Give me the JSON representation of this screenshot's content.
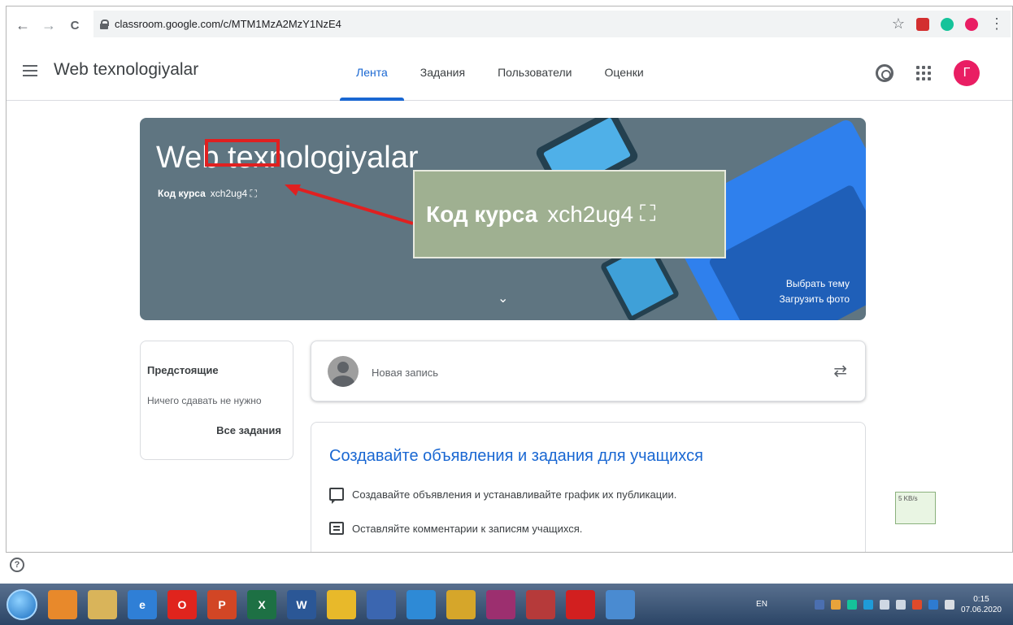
{
  "browser": {
    "url": "classroom.google.com/c/MTM1MzA2MzY1NzE4",
    "back_icon": "←",
    "forward_icon": "→",
    "reload_icon": "C"
  },
  "header": {
    "title": "Web texnologiyalar",
    "tabs": [
      {
        "label": "Лента",
        "active": true
      },
      {
        "label": "Задания"
      },
      {
        "label": "Пользователи"
      },
      {
        "label": "Оценки"
      }
    ],
    "avatar_letter": "Г"
  },
  "banner": {
    "title": "Web texnologiyalar",
    "code_label": "Код курса",
    "code_value": "xch2ug4",
    "select_theme": "Выбрать тему",
    "upload_photo": "Загрузить фото",
    "expand_icon": "⌄"
  },
  "callout": {
    "code_label": "Код курса",
    "code_value": "xch2ug4"
  },
  "upcoming": {
    "title": "Предстоящие",
    "subtitle": "Ничего сдавать не нужно",
    "link": "Все задания"
  },
  "new_post": {
    "placeholder": "Новая запись",
    "repost_icon": "⇄"
  },
  "info": {
    "title": "Создавайте объявления и задания для учащихся",
    "row1": "Создавайте объявления и устанавливайте график их публикации.",
    "row2": "Оставляйте комментарии к записям учащихся."
  },
  "net_widget": {
    "text": "5 KB/s"
  },
  "help_icon": "?",
  "taskbar": {
    "apps": [
      {
        "name": "media-player",
        "label": "",
        "color": "#e8892b"
      },
      {
        "name": "files",
        "label": "",
        "color": "#d9b45a"
      },
      {
        "name": "internet-explorer",
        "label": "e",
        "color": "#2f7fd6"
      },
      {
        "name": "opera",
        "label": "O",
        "color": "#e0241d"
      },
      {
        "name": "powerpoint",
        "label": "P",
        "color": "#d24625"
      },
      {
        "name": "excel",
        "label": "X",
        "color": "#1d7044"
      },
      {
        "name": "word",
        "label": "W",
        "color": "#2b5796"
      },
      {
        "name": "chrome",
        "label": "",
        "color": "#e8b92a"
      },
      {
        "name": "save",
        "label": "",
        "color": "#3b66b0"
      },
      {
        "name": "app-blue",
        "label": "",
        "color": "#2e8ad6"
      },
      {
        "name": "app-yellow",
        "label": "",
        "color": "#d6a62a"
      },
      {
        "name": "winrar",
        "label": "",
        "color": "#9c2f6f"
      },
      {
        "name": "snipping",
        "label": "",
        "color": "#b63a3a"
      },
      {
        "name": "acrobat",
        "label": "",
        "color": "#d21f1f"
      },
      {
        "name": "paint",
        "label": "",
        "color": "#4a8bd1"
      }
    ],
    "lang": "EN",
    "time": "0:15",
    "date": "07.06.2020"
  }
}
